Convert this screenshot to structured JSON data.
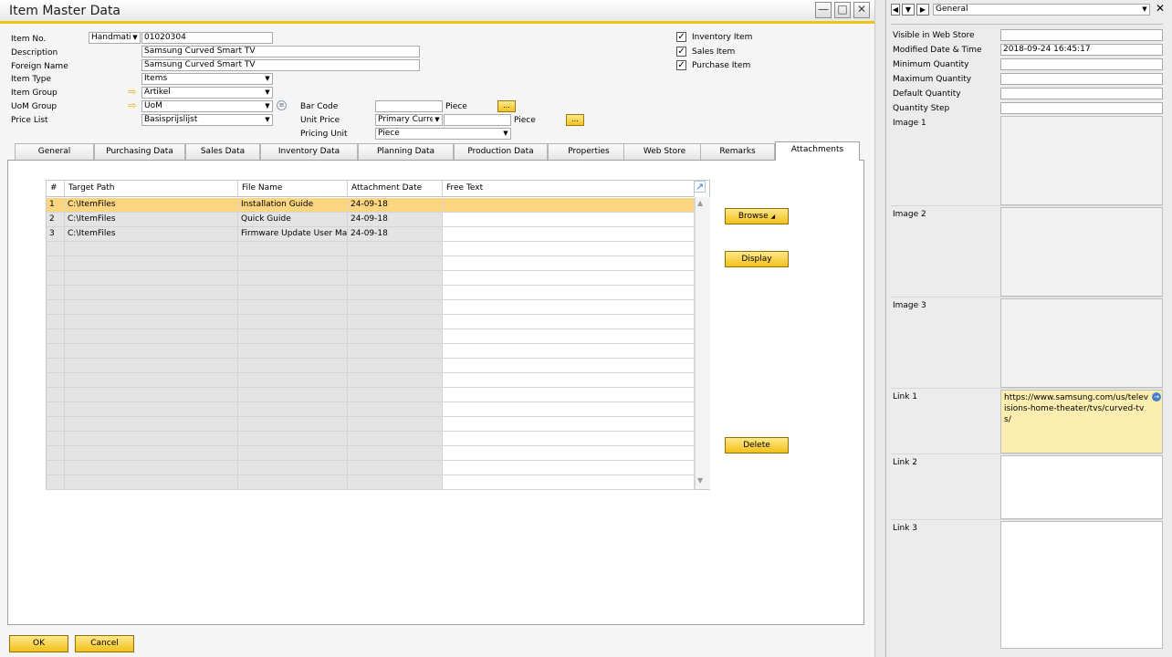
{
  "window": {
    "title": "Item Master Data"
  },
  "header": {
    "item_no_label": "Item No.",
    "item_no_series": "Handmati",
    "item_no_value": "01020304",
    "description_label": "Description",
    "description_value": "Samsung Curved Smart TV",
    "foreign_name_label": "Foreign Name",
    "foreign_name_value": "Samsung Curved Smart TV",
    "item_type_label": "Item Type",
    "item_type_value": "Items",
    "item_group_label": "Item Group",
    "item_group_value": "Artikel",
    "uom_group_label": "UoM Group",
    "uom_group_value": "UoM",
    "price_list_label": "Price List",
    "price_list_value": "Basisprijslijst",
    "bar_code_label": "Bar Code",
    "bar_code_value": "",
    "bar_code_unit": "Piece",
    "unit_price_label": "Unit Price",
    "unit_price_type": "Primary Curre",
    "unit_price_value": "",
    "unit_price_unit": "Piece",
    "pricing_unit_label": "Pricing Unit",
    "pricing_unit_value": "Piece",
    "dots": "...",
    "checkboxes": [
      {
        "label": "Inventory Item",
        "checked": true
      },
      {
        "label": "Sales Item",
        "checked": true
      },
      {
        "label": "Purchase Item",
        "checked": true
      }
    ]
  },
  "tabs": [
    {
      "label": "General"
    },
    {
      "label": "Purchasing Data"
    },
    {
      "label": "Sales Data"
    },
    {
      "label": "Inventory Data"
    },
    {
      "label": "Planning Data"
    },
    {
      "label": "Production Data"
    },
    {
      "label": "Properties"
    },
    {
      "label": "Web Store"
    },
    {
      "label": "Remarks"
    },
    {
      "label": "Attachments",
      "active": true
    }
  ],
  "attachments": {
    "columns": [
      "#",
      "Target Path",
      "File Name",
      "Attachment Date",
      "Free Text"
    ],
    "rows": [
      {
        "num": "1",
        "path": "C:\\ItemFiles",
        "file": "Installation Guide",
        "date": "24-09-18",
        "text": ""
      },
      {
        "num": "2",
        "path": "C:\\ItemFiles",
        "file": "Quick Guide",
        "date": "24-09-18",
        "text": ""
      },
      {
        "num": "3",
        "path": "C:\\ItemFiles",
        "file": "Firmware Update User Ma",
        "date": "24-09-18",
        "text": ""
      }
    ],
    "buttons": {
      "browse": "Browse",
      "display": "Display",
      "delete": "Delete"
    }
  },
  "footer": {
    "ok": "OK",
    "cancel": "Cancel"
  },
  "side_panel": {
    "dropdown_value": "General",
    "fields": [
      {
        "label": "Visible in Web Store",
        "value": ""
      },
      {
        "label": "Modified Date & Time",
        "value": "2018-09-24 16:45:17"
      },
      {
        "label": "Minimum Quantity",
        "value": ""
      },
      {
        "label": "Maximum Quantity",
        "value": ""
      },
      {
        "label": "Default Quantity",
        "value": ""
      },
      {
        "label": "Quantity Step",
        "value": ""
      }
    ],
    "images": [
      {
        "label": "Image 1"
      },
      {
        "label": "Image 2"
      },
      {
        "label": "Image 3"
      }
    ],
    "links": [
      {
        "label": "Link 1",
        "value": "https://www.samsung.com/us/televisions-home-theater/tvs/curved-tvs/"
      },
      {
        "label": "Link 2",
        "value": ""
      },
      {
        "label": "Link 3",
        "value": ""
      }
    ]
  },
  "colors": {
    "accent": "#f0c417",
    "selected_row": "#fbd580",
    "button": "#f2c019"
  }
}
